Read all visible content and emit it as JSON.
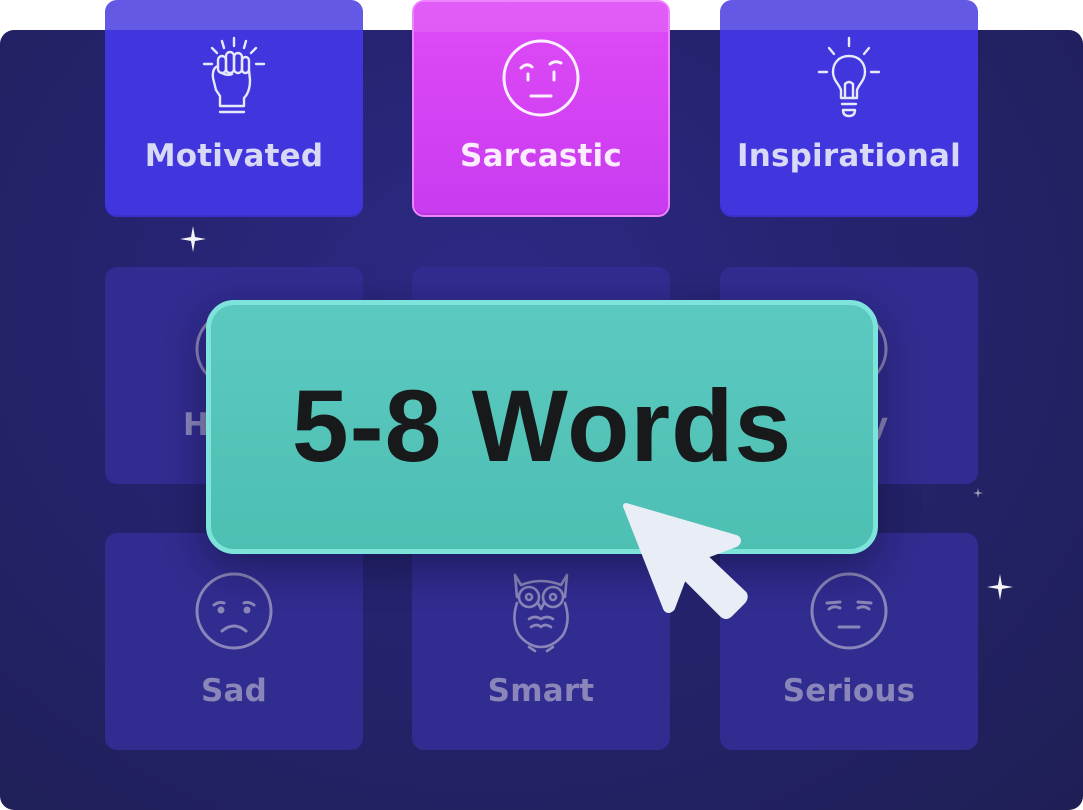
{
  "tiles": {
    "motivated": {
      "label": "Motivated",
      "icon": "raised-fist-icon"
    },
    "sarcastic": {
      "label": "Sarcastic",
      "icon": "skeptical-face-icon"
    },
    "inspirational": {
      "label": "Inspirational",
      "icon": "lightbulb-icon"
    },
    "happy": {
      "label": "H",
      "icon": "face-icon"
    },
    "middle": {
      "label": "",
      "icon": ""
    },
    "funny": {
      "label": "y",
      "icon": "face-icon"
    },
    "sad": {
      "label": "Sad",
      "icon": "sad-face-icon"
    },
    "smart": {
      "label": "Smart",
      "icon": "owl-icon"
    },
    "serious": {
      "label": "Serious",
      "icon": "serious-face-icon"
    }
  },
  "word_count": {
    "label": "5-8 Words"
  },
  "colors": {
    "panel": "#25236e",
    "tile_selected": "#df4bf6",
    "tile_top": "#4135de",
    "pill": "#5cc9c0",
    "cursor": "#e9edf6"
  }
}
